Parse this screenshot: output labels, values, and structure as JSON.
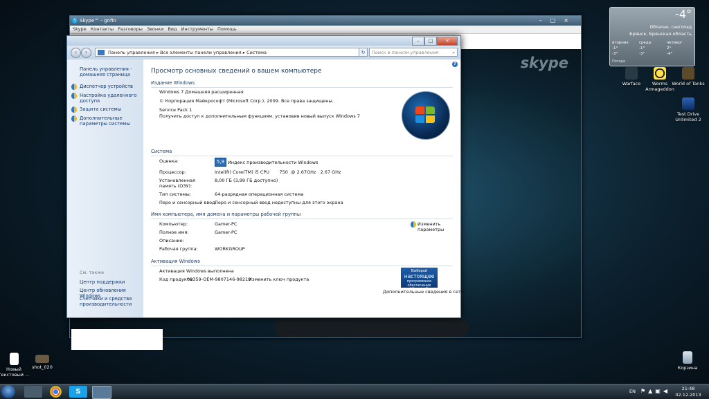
{
  "skype": {
    "title": "Skype™ - gnfin",
    "menu": [
      "Skype",
      "Контакты",
      "Разговоры",
      "Звонки",
      "Вид",
      "Инструменты",
      "Помощь"
    ],
    "logo": "skype"
  },
  "cp": {
    "breadcrumb": [
      "Панель управления",
      "Все элементы панели управления",
      "Система"
    ],
    "search_placeholder": "Поиск в панели управления",
    "left": {
      "home": "Панель управления - домашняя страница",
      "links": [
        "Диспетчер устройств",
        "Настройка удаленного доступа",
        "Защита системы",
        "Дополнительные параметры системы"
      ],
      "see_also": "См. также",
      "see_links": [
        "Центр поддержки",
        "Центр обновления Windows",
        "Счетчики и средства производительности"
      ]
    },
    "heading": "Просмотр основных сведений о вашем компьютере",
    "edition": {
      "title": "Издание Windows",
      "name": "Windows 7 Домашняя расширенная",
      "copyright": "© Корпорация Майкрософт (Microsoft Corp.), 2009. Все права защищены.",
      "sp": "Service Pack 1",
      "upgrade": "Получить доступ к дополнительным функциям, установив новый выпуск Windows 7"
    },
    "system": {
      "title": "Система",
      "rating_label": "Оценка:",
      "rating_value": "5,9",
      "rating_link": "Индекс производительности Windows",
      "cpu_label": "Процессор:",
      "cpu_value": "Intel(R) Core(TM) i5 CPU       750  @ 2.67GHz   2.67 GHz",
      "ram_label": "Установленная память (ОЗУ):",
      "ram_value": "8,00 ГБ (3,99 ГБ доступно)",
      "type_label": "Тип системы:",
      "type_value": "64-разрядная операционная система",
      "pen_label": "Перо и сенсорный ввод:",
      "pen_value": "Перо и сенсорный ввод недоступны для этого экрана"
    },
    "computer": {
      "title": "Имя компьютера, имя домена и параметры рабочей группы",
      "name_label": "Компьютер:",
      "name_value": "Gamer-PC",
      "full_label": "Полное имя:",
      "full_value": "Gamer-PC",
      "desc_label": "Описание:",
      "wg_label": "Рабочая группа:",
      "wg_value": "WORKGROUP",
      "change": "Изменить параметры"
    },
    "activation": {
      "title": "Активация Windows",
      "status": "Активация Windows выполнена",
      "key_label": "Код продукта:",
      "key_value": "00359-OEM-9807146-98219",
      "change_key": "Изменить ключ продукта",
      "genuine_top": "Выбирай",
      "genuine_big": "настоящее",
      "genuine_mid": "программное обеспечение",
      "genuine_brand": "Microsoft",
      "more": "Дополнительные сведения в сети..."
    }
  },
  "gadget": {
    "temp": "-4°",
    "place": "Брянск, Брянская область",
    "now": "Облачно, снегопад",
    "days": [
      "вторник",
      "среда",
      "четверг"
    ],
    "highs": [
      "-1°",
      "-1°",
      "2°"
    ],
    "lows": [
      "-3°",
      "-3°",
      "-4°"
    ],
    "source": "Погода"
  },
  "desktop": {
    "icons": [
      {
        "label": "Warface"
      },
      {
        "label": "Worms Armageddon"
      },
      {
        "label": "World of Tanks"
      },
      {
        "label": "Test Drive Unlimited 2"
      },
      {
        "label": "Новый текстовый ..."
      },
      {
        "label": "shot_020"
      },
      {
        "label": "Корзина"
      }
    ]
  },
  "taskbar": {
    "lang": "EN",
    "time": "21:48",
    "date": "02.12.2013"
  }
}
